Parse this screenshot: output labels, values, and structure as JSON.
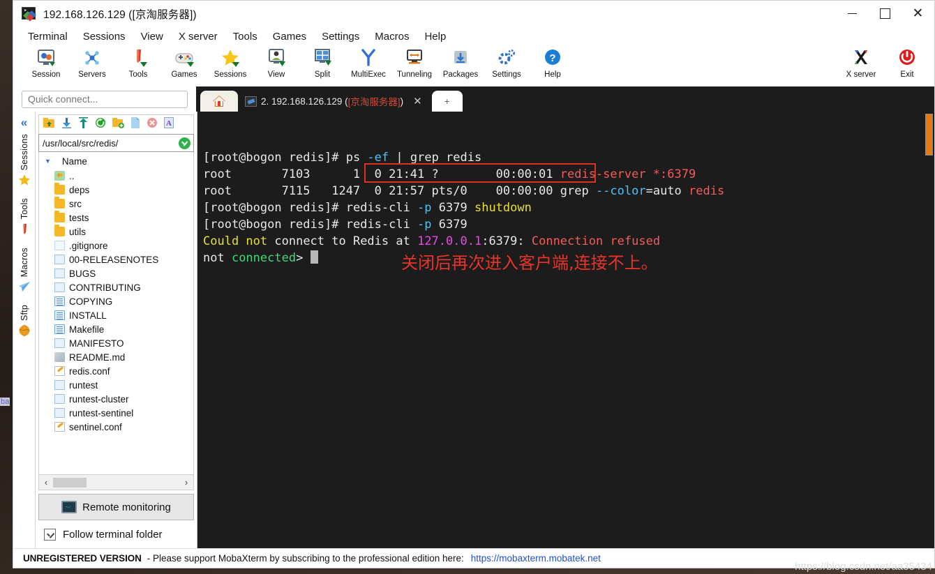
{
  "window": {
    "title": "192.168.126.129 ([京淘服务器])",
    "app_icon": "mobaxterm-icon",
    "controls": {
      "minimize": "–",
      "maximize": "□",
      "close": "✕"
    }
  },
  "menubar": {
    "items": [
      "Terminal",
      "Sessions",
      "View",
      "X server",
      "Tools",
      "Games",
      "Settings",
      "Macros",
      "Help"
    ]
  },
  "toolbar": {
    "items": [
      {
        "label": "Session",
        "icon": "session-icon"
      },
      {
        "label": "Servers",
        "icon": "servers-icon"
      },
      {
        "label": "Tools",
        "icon": "tools-icon"
      },
      {
        "label": "Games",
        "icon": "games-icon"
      },
      {
        "label": "Sessions",
        "icon": "sessions-star-icon"
      },
      {
        "label": "View",
        "icon": "view-icon"
      },
      {
        "label": "Split",
        "icon": "split-icon"
      },
      {
        "label": "MultiExec",
        "icon": "multiexec-icon"
      },
      {
        "label": "Tunneling",
        "icon": "tunneling-icon"
      },
      {
        "label": "Packages",
        "icon": "packages-icon"
      },
      {
        "label": "Settings",
        "icon": "settings-gear-icon"
      },
      {
        "label": "Help",
        "icon": "help-icon"
      }
    ],
    "right_items": [
      {
        "label": "X server",
        "icon": "xserver-icon"
      },
      {
        "label": "Exit",
        "icon": "exit-power-icon"
      }
    ]
  },
  "quick_connect": {
    "placeholder": "Quick connect...",
    "value": ""
  },
  "tabs": {
    "home_icon": "home-icon",
    "active": {
      "label": "2.  192.168.126.129  (",
      "label_zh": "[京淘服务器]",
      "label_tail": ")",
      "close": "✕"
    },
    "new_tab": "+"
  },
  "rail": {
    "collapse": "«",
    "items": [
      {
        "label": "Sessions",
        "icon": "star-icon"
      },
      {
        "label": "Tools",
        "icon": "knife-icon"
      },
      {
        "label": "Macros",
        "icon": "paperplane-icon"
      },
      {
        "label": "Sftp",
        "icon": "globe-icon"
      }
    ]
  },
  "sftp": {
    "toolbar_icons": [
      "go-up-icon",
      "download-icon",
      "upload-icon",
      "refresh-icon",
      "new-folder-icon",
      "new-file-icon",
      "delete-icon",
      "text-mode-icon"
    ],
    "path": "/usr/local/src/redis/",
    "path_status": "connected-ok",
    "column_header": "Name",
    "files": [
      {
        "name": "..",
        "type": "up"
      },
      {
        "name": "deps",
        "type": "folder"
      },
      {
        "name": "src",
        "type": "folder"
      },
      {
        "name": "tests",
        "type": "folder"
      },
      {
        "name": "utils",
        "type": "folder"
      },
      {
        "name": ".gitignore",
        "type": "filepale"
      },
      {
        "name": "00-RELEASENOTES",
        "type": "file"
      },
      {
        "name": "BUGS",
        "type": "file"
      },
      {
        "name": "CONTRIBUTING",
        "type": "file"
      },
      {
        "name": "COPYING",
        "type": "doc"
      },
      {
        "name": "INSTALL",
        "type": "doc"
      },
      {
        "name": "Makefile",
        "type": "doc"
      },
      {
        "name": "MANIFESTO",
        "type": "file"
      },
      {
        "name": "README.md",
        "type": "md"
      },
      {
        "name": "redis.conf",
        "type": "conf"
      },
      {
        "name": "runtest",
        "type": "file"
      },
      {
        "name": "runtest-cluster",
        "type": "file"
      },
      {
        "name": "runtest-sentinel",
        "type": "file"
      },
      {
        "name": "sentinel.conf",
        "type": "conf"
      }
    ],
    "hscroll": {
      "left": "‹",
      "right": "›"
    },
    "remote_monitoring": "Remote monitoring",
    "follow_terminal_folder": {
      "label": "Follow terminal folder",
      "checked": true
    }
  },
  "terminal": {
    "annotation": "关闭后再次进入客户端,连接不上。",
    "highlight_box": "redis-cli -p 6379 shutdown",
    "lines": [
      [
        {
          "t": "[root@bogon redis]# ",
          "c": "white"
        },
        {
          "t": "ps ",
          "c": "white"
        },
        {
          "t": "-ef ",
          "c": "cyan"
        },
        {
          "t": "| ",
          "c": "white"
        },
        {
          "t": "grep ",
          "c": "white"
        },
        {
          "t": "redis",
          "c": "white"
        }
      ],
      [
        {
          "t": "root       7103      1  0 21:41 ?        00:00:01 ",
          "c": "white"
        },
        {
          "t": "redis-server *:6379",
          "c": "red"
        }
      ],
      [
        {
          "t": "root       7115   1247  0 21:57 pts/0    00:00:00 ",
          "c": "white"
        },
        {
          "t": "grep ",
          "c": "white"
        },
        {
          "t": "--color",
          "c": "cyan"
        },
        {
          "t": "=auto ",
          "c": "white"
        },
        {
          "t": "redis",
          "c": "red"
        }
      ],
      [
        {
          "t": "[root@bogon redis]# ",
          "c": "white"
        },
        {
          "t": "redis-cli ",
          "c": "white"
        },
        {
          "t": "-p ",
          "c": "cyan"
        },
        {
          "t": "6379 ",
          "c": "white"
        },
        {
          "t": "shutdown",
          "c": "yellow"
        }
      ],
      [
        {
          "t": "[root@bogon redis]# ",
          "c": "white"
        },
        {
          "t": "redis-cli ",
          "c": "white"
        },
        {
          "t": "-p ",
          "c": "cyan"
        },
        {
          "t": "6379",
          "c": "white"
        }
      ],
      [
        {
          "t": "Could ",
          "c": "yellow"
        },
        {
          "t": "not ",
          "c": "yellow"
        },
        {
          "t": "connect to Redis at ",
          "c": "white"
        },
        {
          "t": "127.0.0.1",
          "c": "magenta"
        },
        {
          "t": ":6379: ",
          "c": "white"
        },
        {
          "t": "Connection refused",
          "c": "red"
        }
      ],
      [
        {
          "t": "not ",
          "c": "white"
        },
        {
          "t": "connected",
          "c": "green"
        },
        {
          "t": "> ",
          "c": "white"
        }
      ]
    ],
    "scrollbar_color": "#e8790c"
  },
  "statusbar": {
    "unregistered": "UNREGISTERED VERSION",
    "message": "-  Please support MobaXterm by subscribing to the professional edition here:",
    "link": "https://mobaxterm.mobatek.net"
  },
  "watermark": "https://blog.csdn.net/aa35434",
  "desktop_artifact": "ba",
  "colors": {
    "accent_blue": "#2f6fd0",
    "terminal_bg": "#1c1c1c",
    "highlight_red": "#e03020",
    "annotation_red": "#e8342a",
    "scrollbar_orange": "#e8790c",
    "link_blue": "#2050d0"
  }
}
